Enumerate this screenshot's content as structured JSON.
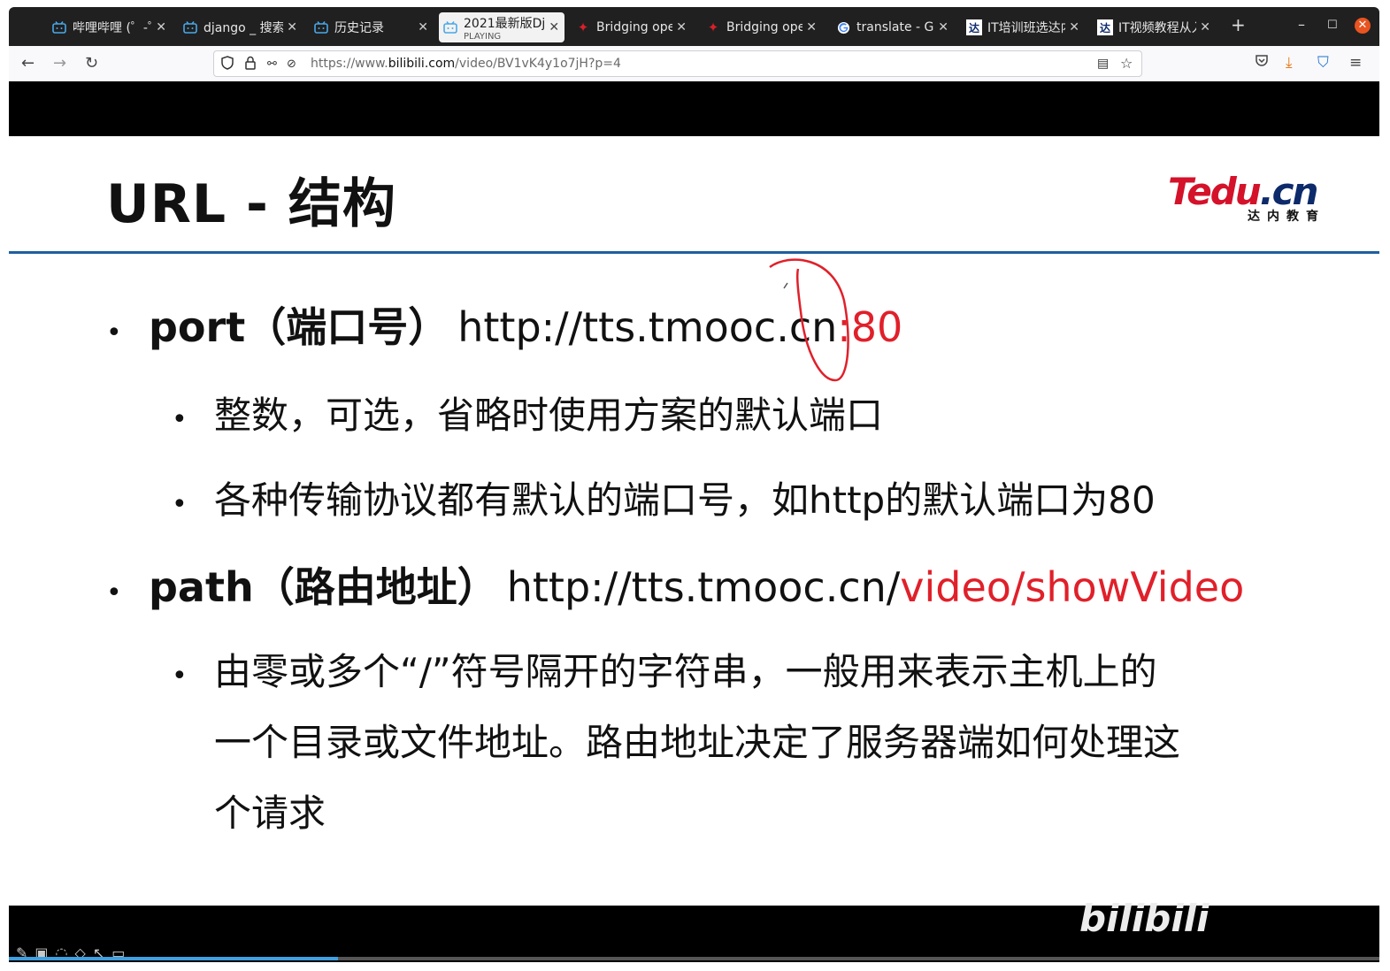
{
  "browser": {
    "tabs": [
      {
        "title": "哔哩哔哩 (゜-゜",
        "icon": "bilibili-icon",
        "active": false
      },
      {
        "title": "django _ 搜索",
        "icon": "bilibili-icon",
        "active": false
      },
      {
        "title": "历史记录",
        "icon": "bilibili-icon",
        "active": false
      },
      {
        "title": "2021最新版Dj",
        "subtitle": "PLAYING",
        "icon": "bilibili-icon",
        "active": true
      },
      {
        "title": "Bridging oper",
        "icon": "maple-leaf-icon",
        "active": false
      },
      {
        "title": "Bridging oper",
        "icon": "maple-leaf-icon",
        "active": false
      },
      {
        "title": "translate - Go",
        "icon": "google-icon",
        "active": false
      },
      {
        "title": "IT培训班选达内",
        "icon": "tedu-icon",
        "active": false
      },
      {
        "title": "IT视频教程从入",
        "icon": "tedu-icon",
        "active": false
      }
    ],
    "url_prefix": "https://www.",
    "url_domain": "bilibili.com",
    "url_path": "/video/BV1vK4y1o7jH?p=4"
  },
  "slide": {
    "title": "URL - 结构",
    "logo_main": "Tedu",
    "logo_cn": ".cn",
    "logo_sub": "达内教育",
    "port_label": "port（端口号）",
    "port_url": "http://tts.tmooc.cn",
    "port_highlight": ":80",
    "port_note_1": "整数，可选，省略时使用方案的默认端口",
    "port_note_2": "各种传输协议都有默认的端口号，如http的默认端口为80",
    "path_label": "path（路由地址）",
    "path_url": "http://tts.tmooc.cn/",
    "path_highlight": "video/showVideo",
    "path_note_line1": "由零或多个“/”符号隔开的字符串，一般用来表示主机上的",
    "path_note_line2": "一个目录或文件地址。路由地址决定了服务器端如何处理这",
    "path_note_line3": "个请求"
  },
  "player": {
    "watermark": "bilibili",
    "progress": 0.24
  },
  "colors": {
    "accent_red": "#e0202a",
    "rule_blue": "#1f5fa0",
    "tab_bg": "#202020",
    "progress_blue": "#3ea0e0"
  }
}
